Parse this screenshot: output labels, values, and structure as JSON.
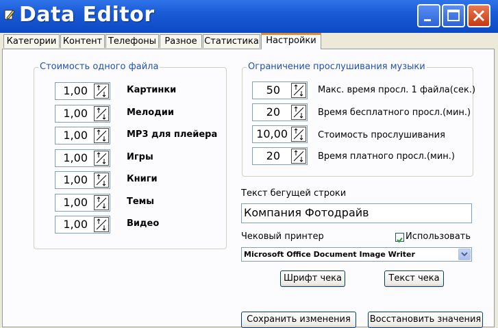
{
  "window": {
    "title": "Data Editor",
    "buttons": {
      "minimize": "minimize",
      "maximize": "maximize",
      "close": "close"
    }
  },
  "tabs": [
    {
      "label": "Категории",
      "active": false
    },
    {
      "label": "Контент",
      "active": false
    },
    {
      "label": "Телефоны",
      "active": false
    },
    {
      "label": "Разное",
      "active": false
    },
    {
      "label": "Статистика",
      "active": false
    },
    {
      "label": "Настройки",
      "active": true
    }
  ],
  "file_cost": {
    "title": "Стоимость одного файла",
    "items": [
      {
        "value": "1,00",
        "label": "Картинки"
      },
      {
        "value": "1,00",
        "label": "Мелодии"
      },
      {
        "value": "1,00",
        "label": "MP3 для плейера"
      },
      {
        "value": "1,00",
        "label": "Игры"
      },
      {
        "value": "1,00",
        "label": "Книги"
      },
      {
        "value": "1,00",
        "label": "Темы"
      },
      {
        "value": "1,00",
        "label": "Видео"
      }
    ]
  },
  "music_limit": {
    "title": "Ограничение прослушивания музыки",
    "items": [
      {
        "value": "50",
        "label": "Макс. время просл. 1 файла(сек.)"
      },
      {
        "value": "20",
        "label": "Время бесплатного просл.(мин.)"
      },
      {
        "value": "10,00",
        "label": "Стоимость прослушивания"
      },
      {
        "value": "20",
        "label": "Время платного просл.(мин.)"
      }
    ]
  },
  "ticker": {
    "label": "Текст бегущей строки",
    "value": "Компания Фотодрайв"
  },
  "printer": {
    "label": "Чековый принтер",
    "use_label": "Использовать",
    "use_checked": true,
    "selected": "Microsoft Office Document Image Writer",
    "font_button": "Шрифт чека",
    "text_button": "Текст чека"
  },
  "footer": {
    "save_button": "Сохранить изменения",
    "restore_button": "Восстановить значения"
  },
  "colors": {
    "titlebar": "#0c49c4",
    "group_title": "#1f4fb5",
    "tab_highlight": "#e68b2c"
  },
  "icons": {
    "spin": "up-down-arrows-icon",
    "combo": "chevron-down-icon",
    "check": "checkmark-icon",
    "app": "app-icon"
  }
}
